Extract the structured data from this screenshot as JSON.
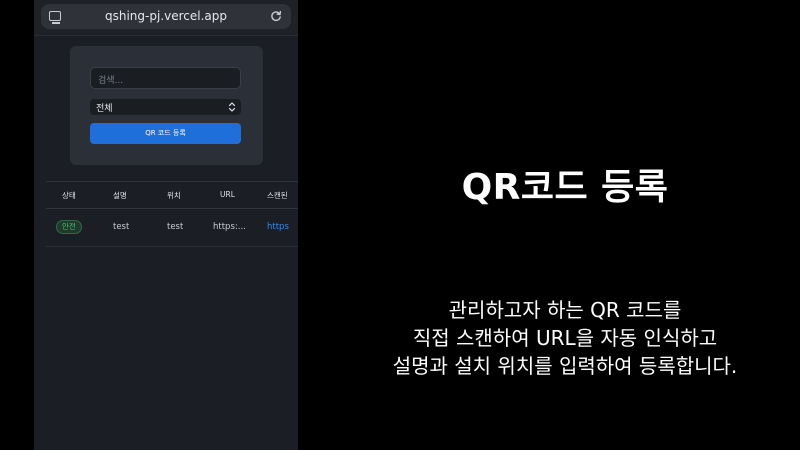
{
  "browser": {
    "url": "qshing-pj.vercel.app"
  },
  "form": {
    "search_placeholder": "검색...",
    "filter_selected": "전체",
    "register_button": "QR 코드 등록"
  },
  "table": {
    "columns": [
      "상태",
      "설명",
      "위치",
      "URL",
      "스캔된"
    ],
    "rows": [
      {
        "status": "안전",
        "description": "test",
        "location": "test",
        "url": "https:...",
        "scanned": "https"
      }
    ]
  },
  "caption": {
    "title": "QR코드 등록",
    "lines": [
      "관리하고자 하는 QR 코드를",
      "직접 스캔하여 URL을 자동 인식하고",
      "설명과 설치 위치를 입력하여 등록합니다."
    ]
  },
  "colors": {
    "accent": "#1f6fdb",
    "safe_badge": "#4cc27a",
    "link": "#3b86e6"
  }
}
